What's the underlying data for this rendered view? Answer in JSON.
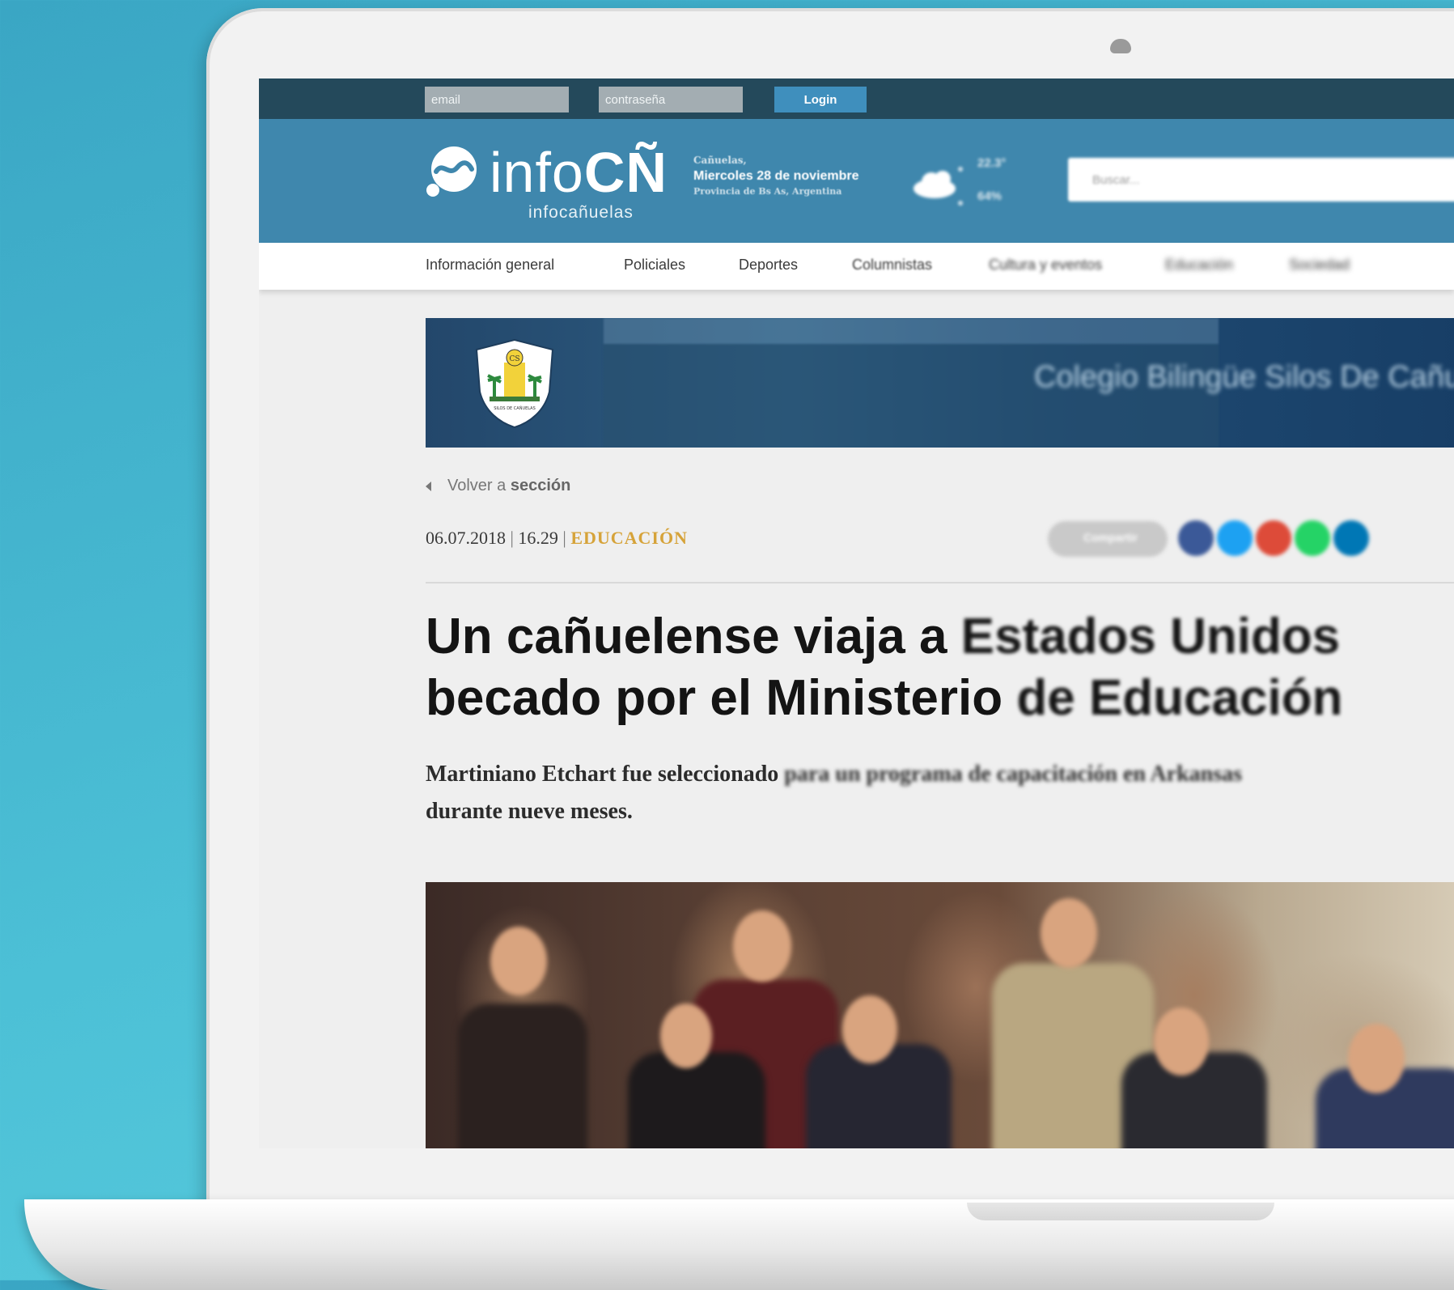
{
  "login": {
    "email_placeholder": "email",
    "password_placeholder": "contraseña",
    "login_label": "Login"
  },
  "logo": {
    "word_light": "info",
    "word_bold": "CÑ",
    "subtitle": "infocañuelas"
  },
  "date": {
    "city": "Cañuelas,",
    "main": "Miercoles 28 de noviembre",
    "province": "Provincia de Bs As, Argentina"
  },
  "weather": {
    "icon": "cloud-icon",
    "temperature": "22.3°",
    "humidity": "64%"
  },
  "search": {
    "placeholder": "Buscar..."
  },
  "nav": {
    "items": [
      {
        "label": "Información general"
      },
      {
        "label": "Policiales"
      },
      {
        "label": "Deportes"
      },
      {
        "label": "Columnistas"
      },
      {
        "label": "Cultura y eventos"
      },
      {
        "label": "Educación"
      },
      {
        "label": "Sociedad"
      }
    ]
  },
  "banner": {
    "shield_label": "SILOS DE CAÑUELAS",
    "shield_monogram": "CS",
    "text": "Colegio Bilingüe Silos De Cañuelas"
  },
  "article": {
    "back_prefix": "Volver a",
    "back_section": "sección",
    "date": "06.07.2018",
    "time": "16.29",
    "category": "EDUCACIÓN",
    "share_label": "Compartir",
    "title_clear_1": "Un cañuelense viaja a ",
    "title_fade_1": "Estados Unidos",
    "title_clear_2": "becado por el Ministerio ",
    "title_fade_2": "de Educación",
    "lead_clear": "Martiniano Etchart fue seleccionado ",
    "lead_fade": "para un programa de capacitación en Arkansas",
    "lead_end": "durante nueve meses."
  },
  "social": {
    "colors": {
      "facebook": "#3b5998",
      "twitter": "#1da1f2",
      "google": "#dd4b39",
      "whatsapp": "#25d366",
      "linkedin": "#0077b5"
    }
  }
}
